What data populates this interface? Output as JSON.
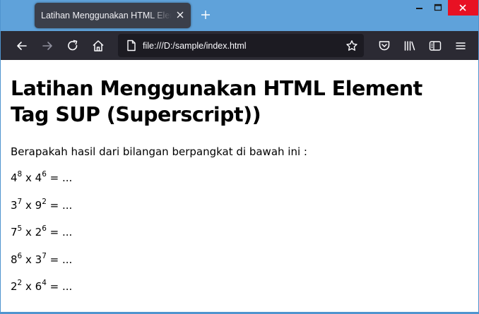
{
  "browser": {
    "tab": {
      "title": "Latihan Menggunakan HTML Element Tag SUP (Superscript))",
      "close_icon": "close-icon"
    },
    "new_tab_icon": "plus-icon",
    "window_controls": [
      "minimize-icon",
      "maximize-icon",
      "close-icon"
    ],
    "close_button_color": "#e81123",
    "toolbar": {
      "buttons_left": [
        "back-arrow-icon",
        "forward-arrow-icon",
        "reload-icon",
        "home-icon"
      ],
      "url": "file:///D:/sample/index.html",
      "buttons_right": [
        "pocket-icon",
        "library-icon",
        "sidebar-icon",
        "hamburger-menu-icon"
      ]
    }
  },
  "page": {
    "heading": "Latihan Menggunakan HTML Element Tag SUP (Superscript))",
    "intro": "Berapakah hasil dari bilangan berpangkat di bawah ini :",
    "expressions": [
      {
        "base1": "4",
        "exp1": "8",
        "op": " x ",
        "base2": "4",
        "exp2": "6",
        "rest": " = ..."
      },
      {
        "base1": "3",
        "exp1": "7",
        "op": " x ",
        "base2": "9",
        "exp2": "2",
        "rest": " = ..."
      },
      {
        "base1": "7",
        "exp1": "5",
        "op": " x ",
        "base2": "2",
        "exp2": "6",
        "rest": " = ..."
      },
      {
        "base1": "8",
        "exp1": "6",
        "op": " x ",
        "base2": "3",
        "exp2": "7",
        "rest": " = ..."
      },
      {
        "base1": "2",
        "exp1": "2",
        "op": " x ",
        "base2": "6",
        "exp2": "4",
        "rest": " = ..."
      }
    ]
  }
}
